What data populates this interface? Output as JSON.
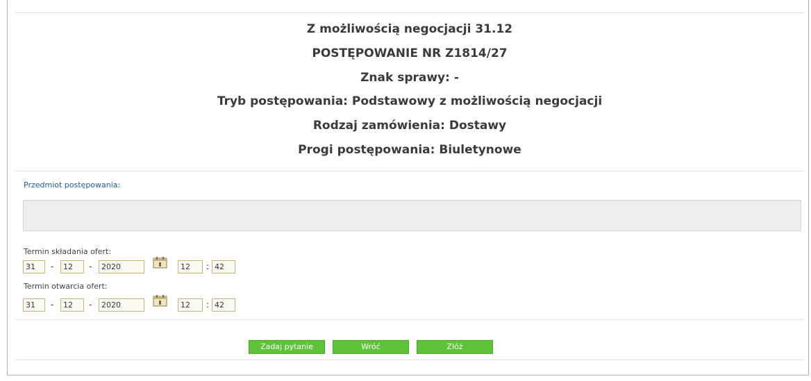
{
  "header": {
    "title": "Z możliwością negocjacji 31.12",
    "number": "POSTĘPOWANIE NR Z1814/27",
    "case_ref": "Znak sprawy: -",
    "mode": "Tryb postępowania: Podstawowy z możliwością negocjacji",
    "order_type": "Rodzaj zamówienia: Dostawy",
    "thresholds": "Progi postępowania: Biuletynowe"
  },
  "subject": {
    "label": "Przedmiot postępowania:",
    "value": ""
  },
  "submission_deadline": {
    "label": "Termin składania ofert:",
    "day": "31",
    "month": "12",
    "year": "2020",
    "hour": "12",
    "minute": "42",
    "date_separator": "-",
    "time_separator": ":"
  },
  "opening_deadline": {
    "label": "Termin otwarcia ofert:",
    "day": "31",
    "month": "12",
    "year": "2020",
    "hour": "12",
    "minute": "42",
    "date_separator": "-",
    "time_separator": ":"
  },
  "actions": {
    "ask_label": "Zadaj pytanie",
    "back_label": "Wróć",
    "submit_label": "Złóż"
  },
  "colors": {
    "button_green": "#5fc33a",
    "label_blue": "#1f5f9e"
  },
  "icons": {
    "calendar": "calendar-icon"
  }
}
